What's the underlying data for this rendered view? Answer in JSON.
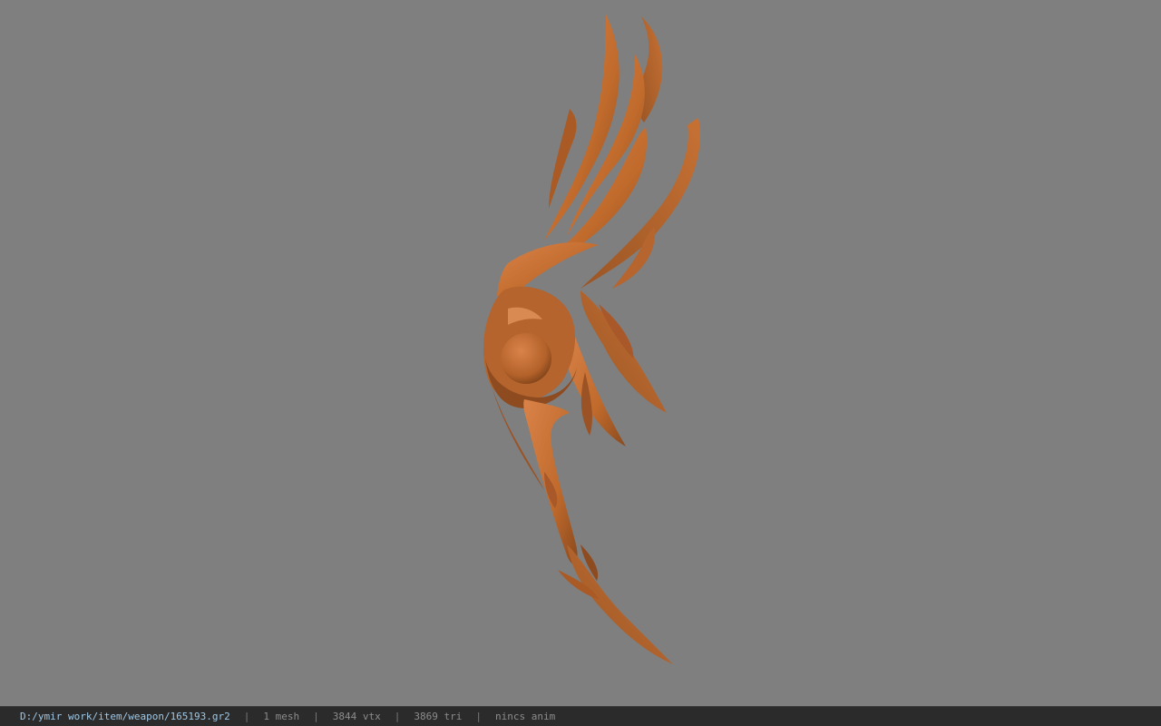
{
  "viewer": {
    "model_color": "#c06a2c",
    "model_shadow": "#8a4a1e",
    "model_highlight": "#d9834a",
    "background": "#7f7f7f"
  },
  "status_bar": {
    "file_path": "D:/ymir work/item/weapon/165193.gr2",
    "separator": "|",
    "mesh_count": "1 mesh",
    "vertex_count": "3844 vtx",
    "triangle_count": "3869 tri",
    "anim_status": "nincs anim"
  }
}
